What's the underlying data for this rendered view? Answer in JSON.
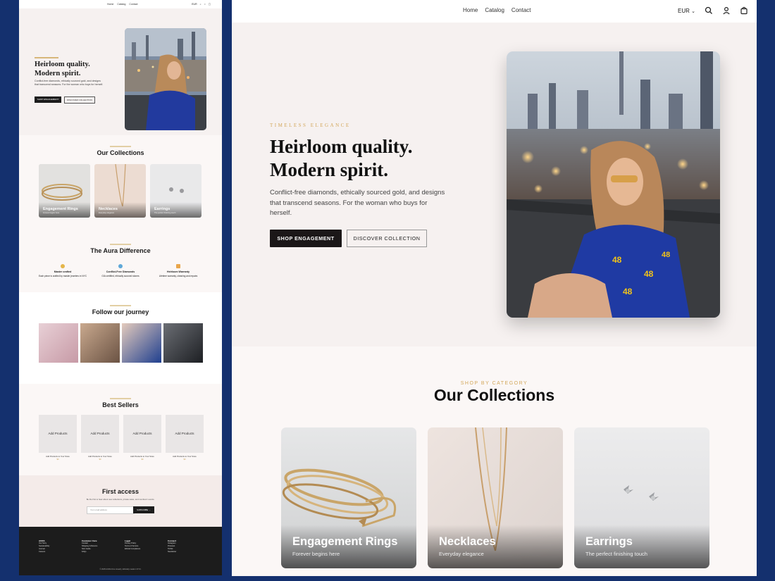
{
  "colors": {
    "frame": "#14306e",
    "accent_gold": "#d3a85c",
    "dark": "#1b1718",
    "hero_bg": "#f6f1f0"
  },
  "main": {
    "nav": {
      "links": [
        "Home",
        "Catalog",
        "Contact"
      ],
      "currency": "EUR",
      "icons": [
        "search-icon",
        "account-icon",
        "bag-icon"
      ]
    },
    "hero": {
      "eyebrow": "TIMELESS ELEGANCE",
      "title_line1": "Heirloom quality.",
      "title_line2": "Modern spirit.",
      "lead": "Conflict-free diamonds, ethically sourced gold, and designs that transcend seasons. For the woman who buys for herself.",
      "primary_button": "SHOP ENGAGEMENT",
      "secondary_button": "DISCOVER COLLECTION"
    },
    "collections": {
      "eyebrow": "SHOP BY CATEGORY",
      "title": "Our Collections",
      "cards": [
        {
          "title": "Engagement Rings",
          "subtitle": "Forever begins here"
        },
        {
          "title": "Necklaces",
          "subtitle": "Everyday elegance"
        },
        {
          "title": "Earrings",
          "subtitle": "The perfect finishing touch"
        }
      ]
    }
  },
  "preview": {
    "nav": {
      "links": [
        "Home",
        "Catalog",
        "Contact"
      ],
      "currency": "EUR"
    },
    "hero": {
      "title_line1": "Heirloom quality.",
      "title_line2": "Modern spirit.",
      "lead": "Conflict-free diamonds, ethically sourced gold, and designs that transcend seasons. For the woman who buys for herself.",
      "primary_button": "SHOP ENGAGEMENT",
      "secondary_button": "DISCOVER COLLECTION"
    },
    "collections": {
      "title": "Our Collections",
      "cards": [
        {
          "title": "Engagement Rings",
          "subtitle": "Forever begins here"
        },
        {
          "title": "Necklaces",
          "subtitle": "Everyday elegance"
        },
        {
          "title": "Earrings",
          "subtitle": "The perfect finishing touch"
        }
      ]
    },
    "difference": {
      "title": "The Aura Difference",
      "features": [
        {
          "title": "Master crafted",
          "text": "Each piece is crafted by master jewelers in NYC"
        },
        {
          "title": "Conflict-Free Diamonds",
          "text": "GIA certified, ethically sourced stones"
        },
        {
          "title": "Heirloom Warranty",
          "text": "Lifetime warranty, cleaning and repairs"
        }
      ]
    },
    "follow": {
      "title": "Follow our journey"
    },
    "best_sellers": {
      "title": "Best Sellers",
      "products": [
        {
          "box": "Add Products",
          "name": "Add Products to Your Store",
          "price": "$0"
        },
        {
          "box": "Add Products",
          "name": "Add Products to Your Store",
          "price": "$0"
        },
        {
          "box": "Add Products",
          "name": "Add Products to Your Store",
          "price": "$0"
        },
        {
          "box": "Add Products",
          "name": "Add Products to Your Store",
          "price": "$0"
        }
      ]
    },
    "first_access": {
      "title": "First access",
      "text": "Be the first to hear about new collections, private sales, and members' events.",
      "input_placeholder": "Your email address",
      "button": "SUBSCRIBE →"
    },
    "footer": {
      "columns": [
        {
          "heading": "AURA",
          "items": [
            "Our Story",
            "Sustainability",
            "Journal",
            "Careers"
          ]
        },
        {
          "heading": "Customer Care",
          "items": [
            "Contact",
            "Shipping & Returns",
            "Size Guide",
            "FAQs"
          ]
        },
        {
          "heading": "Legal",
          "items": [
            "Privacy Policy",
            "Terms of Service",
            "Ethical Compliance"
          ]
        },
        {
          "heading": "Connect",
          "items": [
            "Instagram",
            "Pinterest",
            "TikTok",
            "Newsletter"
          ]
        }
      ],
      "copyright": "© 2025 AURA Fine Jewelry. Ethically made in NYC."
    }
  }
}
